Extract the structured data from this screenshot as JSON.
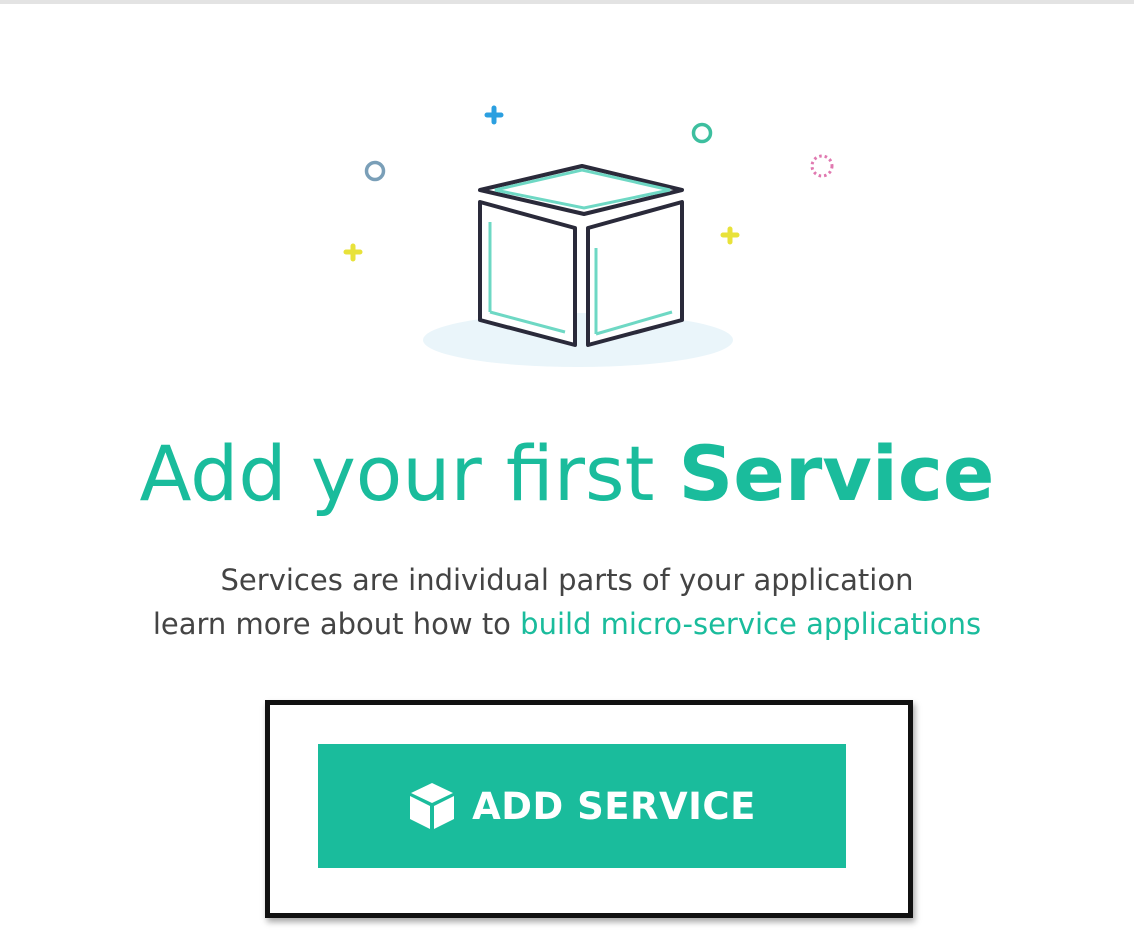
{
  "headline": {
    "text_light": "Add your first ",
    "text_bold": "Service"
  },
  "description": {
    "line1": "Services are individual parts of your application",
    "line2_prefix": "learn more about how to ",
    "link_text": "build micro-service applications"
  },
  "add_button": {
    "label": "ADD SERVICE",
    "icon": "cube-icon"
  },
  "colors": {
    "accent": "#1abc9c",
    "text": "#444444",
    "highlight_border": "#111111"
  },
  "illustration": {
    "icon": "cube-illustration"
  }
}
